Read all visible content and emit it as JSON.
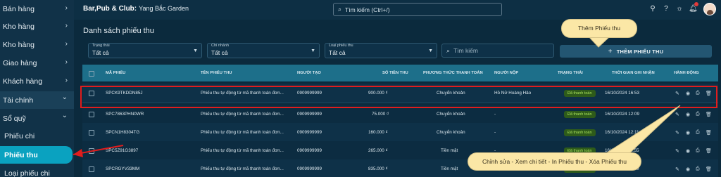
{
  "sidebar": {
    "items": [
      {
        "label": "Bán hàng",
        "chevron": "›"
      },
      {
        "label": "Kho hàng",
        "chevron": "›"
      },
      {
        "label": "Kho hàng",
        "chevron": "›"
      },
      {
        "label": "Giao hàng",
        "chevron": "›"
      },
      {
        "label": "Khách hàng",
        "chevron": "›"
      },
      {
        "label": "Tài chính",
        "chevron": "⌄"
      },
      {
        "label": "Sổ quỹ",
        "chevron": "⌄"
      },
      {
        "label": "Phiếu chi",
        "chevron": ""
      },
      {
        "label": "Phiếu thu",
        "chevron": ""
      },
      {
        "label": "Loại phiếu chi",
        "chevron": ""
      }
    ]
  },
  "header": {
    "brand": "Bar,Pub & Club:",
    "store": "Yang Bắc Garden",
    "search_placeholder": "Tìm kiếm (Ctrl+/)"
  },
  "page": {
    "title": "Danh sách phiếu thu"
  },
  "filters": {
    "status": {
      "label": "Trạng thái",
      "value": "Tất cả"
    },
    "branch": {
      "label": "Chi nhánh",
      "value": "Tất cả"
    },
    "type": {
      "label": "Loại phiếu thu",
      "value": "Tất cả"
    },
    "search_placeholder": "Tìm kiếm",
    "add_button": "THÊM PHIẾU THU"
  },
  "table": {
    "headers": [
      "MÃ PHIẾU",
      "TÊN PHIẾU THU",
      "NGƯỜI TẠO",
      "SỐ TIỀN THU",
      "PHƯƠNG THỨC THANH TOÁN",
      "NGƯỜI NỘP",
      "TRẠNG THÁI",
      "THỜI GIAN GHI NHẬN",
      "HÀNH ĐỘNG"
    ],
    "rows": [
      {
        "code": "SPCK9TKDDN85J",
        "name": "Phiếu thu tự động từ mã thanh toán đơn...",
        "creator": "0909999999",
        "amount": "900.000 ₫",
        "method": "Chuyển khoản",
        "payer": "Hồ Nữ Hoàng Hảo",
        "status": "Đã thanh toán",
        "time": "16/10/2024 16:53"
      },
      {
        "code": "SPC7863PHN0WR",
        "name": "Phiếu thu tự động từ mã thanh toán đơn...",
        "creator": "0909999999",
        "amount": "75.000 ₫",
        "method": "Chuyển khoản",
        "payer": "-",
        "status": "Đã thanh toán",
        "time": "16/10/2024 12:09"
      },
      {
        "code": "SPCN1H8304TG",
        "name": "Phiếu thu tự động từ mã thanh toán đơn...",
        "creator": "0909999999",
        "amount": "160.000 ₫",
        "method": "Chuyển khoản",
        "payer": "-",
        "status": "Đã thanh toán",
        "time": "16/10/2024 12:11"
      },
      {
        "code": "SPC5Z91G3897",
        "name": "Phiếu thu tự động từ mã thanh toán đơn...",
        "creator": "0909999999",
        "amount": "265.000 ₫",
        "method": "Tiền mặt",
        "payer": "-",
        "status": "Đã thanh toán",
        "time": "16/10/2024 11:55"
      },
      {
        "code": "SPCRGYV33MM",
        "name": "Phiếu thu tự động từ mã thanh toán đơn...",
        "creator": "0909999999",
        "amount": "835.000 ₫",
        "method": "Tiền mặt",
        "payer": "Mạc Thiên Nhi",
        "status": "Đã thanh toán",
        "time": "16/10/2024 11:40"
      }
    ]
  },
  "callouts": {
    "add": "Thêm Phiếu thu",
    "actions": "Chỉnh sửa - Xem chi tiết - In Phiếu thu - Xóa Phiếu thu"
  },
  "colors": {
    "accent": "#0aa2c0",
    "highlight": "#e11d1d",
    "callout_bg": "#fbe7a6",
    "status_green": "#a8e05b"
  }
}
